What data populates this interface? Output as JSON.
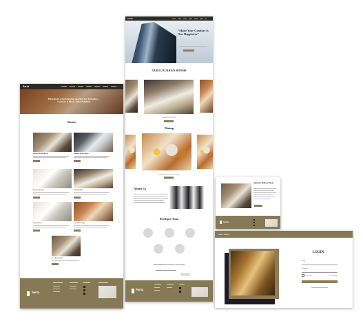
{
  "mockup": {
    "brand": "Serta",
    "hero_left": {
      "headline": "Effortlessly styled sleeping quarters for Travellers – Comfort & Plush, Hotel building"
    },
    "rooms_page": {
      "section_title": "Rooms",
      "rooms": [
        {
          "name": "Superior Deluxe Room"
        },
        {
          "name": "Superior Deluxe Room"
        },
        {
          "name": "Standard Double"
        },
        {
          "name": "Standard Back"
        },
        {
          "name": "Junior Deluxe"
        },
        {
          "name": "Juer Junior Light"
        },
        {
          "name": "Junr Aloue Light"
        }
      ]
    },
    "home_page": {
      "hero_quote": "“Make Your Comfort Is Our Happiness”",
      "rooms_title": "OUR LUXURIOUS ROOMS",
      "featured_room": "Superior Deluxe Room",
      "dining_title": "Dining",
      "about_title": "About Us",
      "team_title": "Developer Team",
      "subscribe_title": "SUBSCRIBE FOR YOUR LOCAL OFFERS"
    },
    "detail_card": {
      "title": "Superior Deluxe Room"
    },
    "login_page": {
      "header_logo": "Serta Hotel",
      "title": "LOGIN",
      "email_label": "Email",
      "password_label": "Password"
    },
    "footer": {
      "brand_text": "Serta"
    },
    "colors": {
      "accent_gold": "#8b7d5a",
      "footer_gold": "#867956",
      "page_bg": "#ffffff"
    }
  }
}
